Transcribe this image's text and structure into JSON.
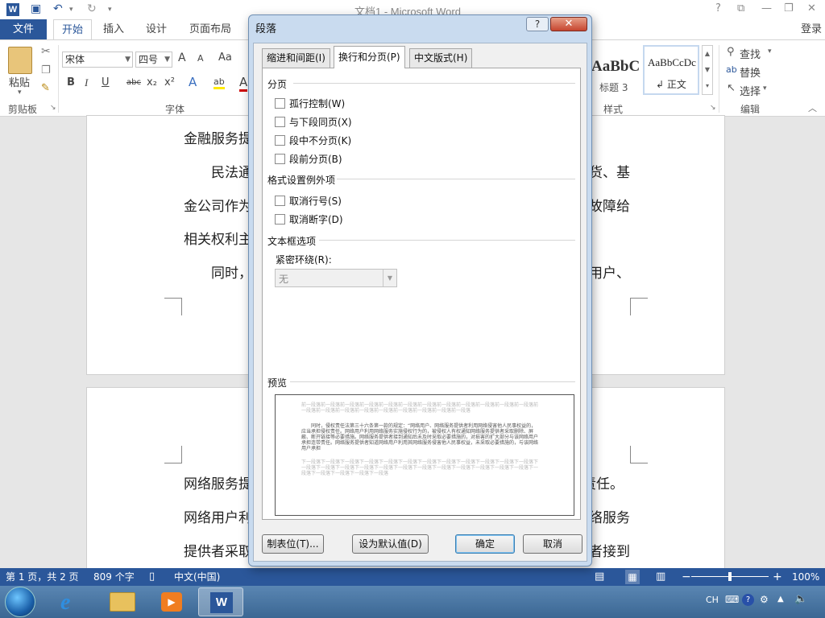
{
  "window": {
    "title": "文档1 - Microsoft Word",
    "app_icon": "W",
    "controls": [
      "?",
      "⧉",
      "—",
      "❐",
      "✕"
    ]
  },
  "ribbon": {
    "file_tab": "文件",
    "tabs": [
      "开始",
      "插入",
      "设计",
      "页面布局"
    ],
    "active_tab": "开始",
    "login": "登录",
    "clipboard": {
      "paste": "粘贴",
      "group": "剪贴板"
    },
    "font": {
      "name": "宋体",
      "size": "四号",
      "group": "字体",
      "grow": "A",
      "shrink": "A",
      "case": "Aa",
      "bold": "B",
      "italic": "I",
      "underline": "U",
      "strike": "abc",
      "sub": "x₂",
      "sup": "x²",
      "effects": "A",
      "highlight": "ab",
      "color": "A"
    },
    "styles": {
      "group": "样式",
      "heading3_preview": "AaBbC",
      "heading3_label": "标题 3",
      "normal_preview": "AaBbCcDc",
      "normal_label": "↲ 正文"
    },
    "editing": {
      "group": "编辑",
      "find": "查找",
      "replace": "替换",
      "select": "选择"
    }
  },
  "document": {
    "page1_lines": [
      {
        "left": "金融服务提",
        "right": ""
      },
      {
        "left": "　　民法通",
        "right": "货、基"
      },
      {
        "left": "金公司作为",
        "right": "故障给"
      },
      {
        "left": "相关权利主",
        "right": ""
      },
      {
        "left": "　　同时，",
        "right": "用户、"
      }
    ],
    "page2_lines": [
      {
        "left": "网络服务提",
        "right": "责任。"
      },
      {
        "left": "网络用户利",
        "right": "络服务"
      },
      {
        "left": "提供者采取",
        "right": "者接到"
      }
    ]
  },
  "statusbar": {
    "page": "第 1 页，共 2 页",
    "words": "809 个字",
    "language": "中文(中国)",
    "zoom": "100%",
    "zoom_fraction": 0.5
  },
  "taskbar": {
    "tray_lang": "CH",
    "tray_help": "?"
  },
  "dialog": {
    "title": "段落",
    "help": "?",
    "close": "✕",
    "tabs": [
      "缩进和间距(I)",
      "换行和分页(P)",
      "中文版式(H)"
    ],
    "active_tab": 1,
    "pagination": {
      "heading": "分页",
      "options": [
        {
          "label": "孤行控制(W)",
          "checked": false
        },
        {
          "label": "与下段同页(X)",
          "checked": false
        },
        {
          "label": "段中不分页(K)",
          "checked": false
        },
        {
          "label": "段前分页(B)",
          "checked": false
        }
      ]
    },
    "exceptions": {
      "heading": "格式设置例外项",
      "options": [
        {
          "label": "取消行号(S)",
          "checked": false
        },
        {
          "label": "取消断字(D)",
          "checked": false
        }
      ]
    },
    "textbox": {
      "heading": "文本框选项",
      "wrap_label": "紧密环绕(R):",
      "wrap_value": "无"
    },
    "preview": {
      "heading": "预览",
      "before": "前一段落前一段落前一段落前一段落前一段落前一段落前一段落前一段落前一段落前一段落前一段落前一段落前一段落前一段落前一段落前一段落前一段落前一段落前一段落前一段落前一段落",
      "sample": "　　同时，侵权责任法第三十六条第一款的规定：“网络用户、网络服务提供者利用网络侵害他人民事权益的，应当承担侵权责任。网络用户利用网络服务实施侵权行为的，被侵权人有权通知网络服务提供者采取删除、屏蔽、断开链接等必要措施。网络服务提供者接到通知后未及时采取必要措施的，对损害的扩大部分与该网络用户承担连带责任。网络服务提供者知道网络用户利用其网络服务侵害他人民事权益，未采取必要措施的，与该网络用户承担",
      "after": "下一段落下一段落下一段落下一段落下一段落下一段落下一段落下一段落下一段落下一段落下一段落下一段落下一段落下一段落下一段落下一段落下一段落下一段落下一段落下一段落下一段落下一段落下一段落下一段落下一段落下一段落下一段落下一段落下一段落"
    },
    "buttons": {
      "tabs": "制表位(T)...",
      "set_default": "设为默认值(D)",
      "ok": "确定",
      "cancel": "取消"
    }
  }
}
